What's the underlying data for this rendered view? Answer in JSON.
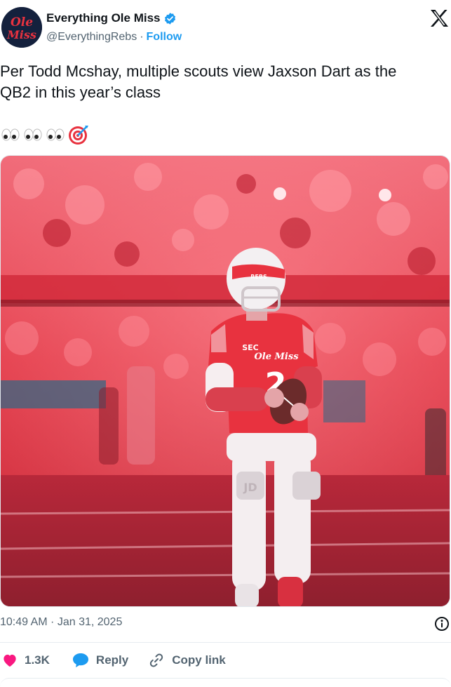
{
  "header": {
    "display_name": "Everything Ole Miss",
    "handle": "@EverythingRebs",
    "separator": "·",
    "follow_label": "Follow",
    "avatar_text_top": "Ole",
    "avatar_text_bottom": "Miss",
    "verified_color": "#1d9bf0"
  },
  "tweet": {
    "text": "Per Todd Mcshay, multiple scouts view Jaxson Dart as the\nQB2 in this year’s class",
    "emojis": [
      "eyes-icon",
      "eyes-icon",
      "eyes-icon",
      "target-icon"
    ]
  },
  "media": {
    "type": "photo",
    "helmet_text": "REBS",
    "jersey_script": "Ole Miss",
    "jersey_number": "2",
    "conference_logo": "SEC",
    "pad_letters": "JD",
    "dominant_color": "#e8323f"
  },
  "meta": {
    "timestamp": "10:49 AM · Jan 31, 2025"
  },
  "actions": {
    "like_count": "1.3K",
    "reply_label": "Reply",
    "copy_label": "Copy link",
    "like_color": "#f91880",
    "reply_color": "#1d9bf0"
  }
}
